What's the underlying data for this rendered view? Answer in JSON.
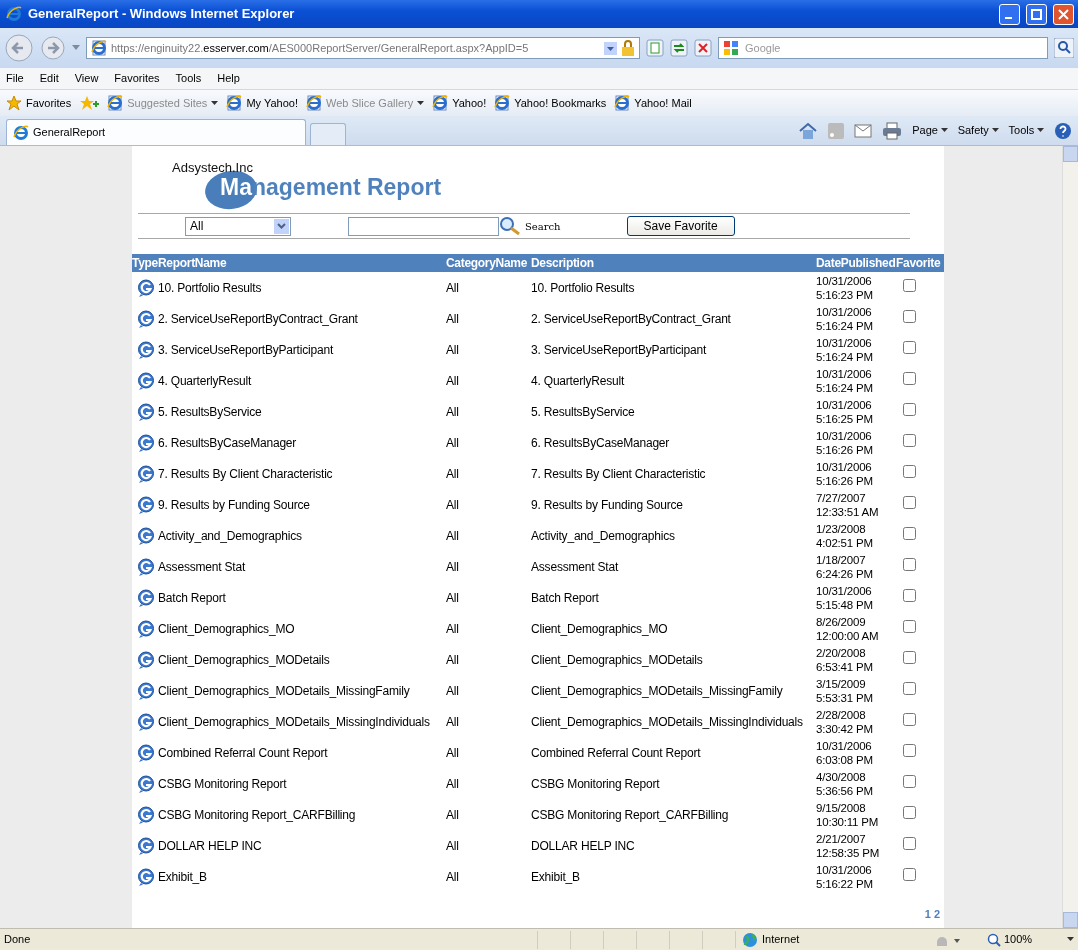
{
  "window": {
    "title": "GeneralReport - Windows Internet Explorer"
  },
  "address_bar": {
    "url": "https://enginuity22.**esserver.com**/AES000ReportServer/GeneralReport.aspx?AppID=5"
  },
  "search_box": {
    "placeholder": "Google"
  },
  "menu": [
    "File",
    "Edit",
    "View",
    "Favorites",
    "Tools",
    "Help"
  ],
  "favorites_bar": {
    "label": "Favorites",
    "items": [
      {
        "label": "Suggested Sites",
        "dropdown": true,
        "dimmed": true
      },
      {
        "label": "My Yahoo!",
        "dropdown": false,
        "dimmed": false
      },
      {
        "label": "Web Slice Gallery",
        "dropdown": true,
        "dimmed": true
      },
      {
        "label": "Yahoo!",
        "dropdown": false,
        "dimmed": false
      },
      {
        "label": "Yahoo! Bookmarks",
        "dropdown": false,
        "dimmed": false
      },
      {
        "label": "Yahoo! Mail",
        "dropdown": false,
        "dimmed": false
      }
    ]
  },
  "tabs": [
    {
      "label": "GeneralReport",
      "selected": true
    }
  ],
  "command_bar": [
    "Page",
    "Safety",
    "Tools"
  ],
  "report": {
    "company": "Adsystech.Inc",
    "title": "Management Report",
    "filter": {
      "value": "All"
    },
    "search_label": "Search",
    "save_button": "Save Favorite",
    "columns": [
      "Type",
      "ReportName",
      "CategoryName",
      "Description",
      "DatePublished",
      "Favorite"
    ],
    "rows": [
      {
        "name": "10. Portfolio Results",
        "category": "All",
        "description": "10. Portfolio Results",
        "date": "10/31/2006",
        "time": "5:16:23 PM",
        "favorite": false
      },
      {
        "name": "2. ServiceUseReportByContract_Grant",
        "category": "All",
        "description": "2. ServiceUseReportByContract_Grant",
        "date": "10/31/2006",
        "time": "5:16:24 PM",
        "favorite": false
      },
      {
        "name": "3. ServiceUseReportByParticipant",
        "category": "All",
        "description": "3. ServiceUseReportByParticipant",
        "date": "10/31/2006",
        "time": "5:16:24 PM",
        "favorite": false
      },
      {
        "name": "4. QuarterlyResult",
        "category": "All",
        "description": "4. QuarterlyResult",
        "date": "10/31/2006",
        "time": "5:16:24 PM",
        "favorite": false
      },
      {
        "name": "5. ResultsByService",
        "category": "All",
        "description": "5. ResultsByService",
        "date": "10/31/2006",
        "time": "5:16:25 PM",
        "favorite": false
      },
      {
        "name": "6. ResultsByCaseManager",
        "category": "All",
        "description": "6. ResultsByCaseManager",
        "date": "10/31/2006",
        "time": "5:16:26 PM",
        "favorite": false
      },
      {
        "name": "7. Results By Client Characteristic",
        "category": "All",
        "description": "7. Results By Client Characteristic",
        "date": "10/31/2006",
        "time": "5:16:26 PM",
        "favorite": false
      },
      {
        "name": "9. Results by Funding Source",
        "category": "All",
        "description": "9. Results by Funding Source",
        "date": "7/27/2007",
        "time": "12:33:51 AM",
        "favorite": false
      },
      {
        "name": "Activity_and_Demographics",
        "category": "All",
        "description": "Activity_and_Demographics",
        "date": "1/23/2008",
        "time": "4:02:51 PM",
        "favorite": false
      },
      {
        "name": "Assessment Stat",
        "category": "All",
        "description": "Assessment Stat",
        "date": "1/18/2007",
        "time": "6:24:26 PM",
        "favorite": false
      },
      {
        "name": "Batch Report",
        "category": "All",
        "description": "Batch Report",
        "date": "10/31/2006",
        "time": "5:15:48 PM",
        "favorite": false
      },
      {
        "name": "Client_Demographics_MO",
        "category": "All",
        "description": "Client_Demographics_MO",
        "date": "8/26/2009",
        "time": "12:00:00 AM",
        "favorite": false
      },
      {
        "name": "Client_Demographics_MODetails",
        "category": "All",
        "description": "Client_Demographics_MODetails",
        "date": "2/20/2008",
        "time": "6:53:41 PM",
        "favorite": false
      },
      {
        "name": "Client_Demographics_MODetails_MissingFamily",
        "category": "All",
        "description": "Client_Demographics_MODetails_MissingFamily",
        "date": "3/15/2009",
        "time": "5:53:31 PM",
        "favorite": false
      },
      {
        "name": "Client_Demographics_MODetails_MissingIndividuals",
        "category": "All",
        "description": "Client_Demographics_MODetails_MissingIndividuals",
        "date": "2/28/2008",
        "time": "3:30:42 PM",
        "favorite": false
      },
      {
        "name": "Combined Referral Count Report",
        "category": "All",
        "description": "Combined Referral Count Report",
        "date": "10/31/2006",
        "time": "6:03:08 PM",
        "favorite": false
      },
      {
        "name": "CSBG Monitoring Report",
        "category": "All",
        "description": "CSBG Monitoring Report",
        "date": "4/30/2008",
        "time": "5:36:56 PM",
        "favorite": false
      },
      {
        "name": "CSBG Monitoring Report_CARFBilling",
        "category": "All",
        "description": "CSBG Monitoring Report_CARFBilling",
        "date": "9/15/2008",
        "time": "10:30:11 PM",
        "favorite": false
      },
      {
        "name": "DOLLAR HELP INC",
        "category": "All",
        "description": "DOLLAR HELP INC",
        "date": "2/21/2007",
        "time": "12:58:35 PM",
        "favorite": false
      },
      {
        "name": "Exhibit_B",
        "category": "All",
        "description": "Exhibit_B",
        "date": "10/31/2006",
        "time": "5:16:22 PM",
        "favorite": false
      }
    ],
    "pages": [
      "1",
      "2"
    ]
  },
  "status_bar": {
    "text": "Done",
    "zone": "Internet",
    "zoom": "100%"
  }
}
